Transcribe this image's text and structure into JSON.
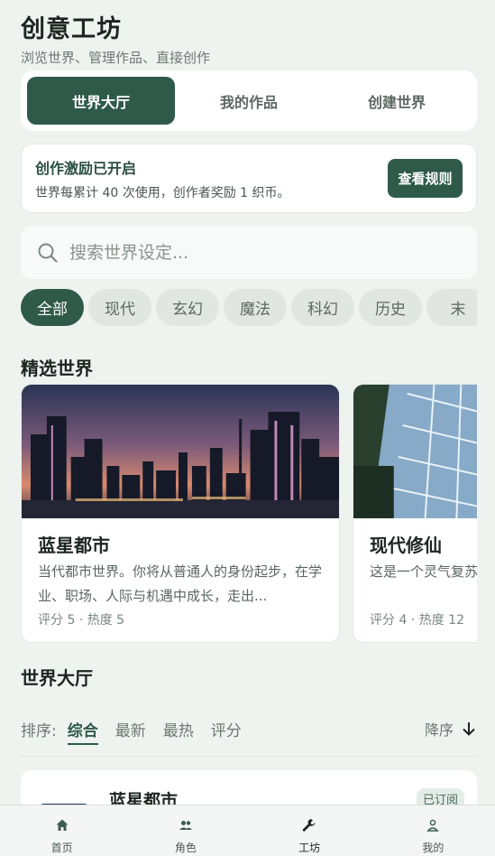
{
  "header": {
    "title": "创意工坊",
    "subtitle": "浏览世界、管理作品、直接创作"
  },
  "tabs": [
    {
      "label": "世界大厅",
      "active": true
    },
    {
      "label": "我的作品",
      "active": false
    },
    {
      "label": "创建世界",
      "active": false
    }
  ],
  "promo": {
    "title": "创作激励已开启",
    "description": "世界每累计 40 次使用，创作者奖励 1 织币。",
    "button_label": "查看规则"
  },
  "search": {
    "placeholder": "搜索世界设定...",
    "icon": "search-icon"
  },
  "categories": [
    "全部",
    "现代",
    "玄幻",
    "魔法",
    "科幻",
    "历史",
    "末"
  ],
  "featured": {
    "title": "精选世界",
    "cards": [
      {
        "title": "蓝星都市",
        "description": "当代都市世界。你将从普通人的身份起步，在学业、职场、人际与机遇中成长，走出...",
        "meta": "评分 5 · 热度 5"
      },
      {
        "title": "现代修仙",
        "description": "这是一个灵气复苏的世界，天地灵气重新充盈",
        "meta": "评分 4 · 热度 12"
      }
    ]
  },
  "hall": {
    "title": "世界大厅",
    "sort_label": "排序:",
    "sort_options": [
      {
        "label": "综合",
        "active": true
      },
      {
        "label": "最新",
        "active": false
      },
      {
        "label": "最热",
        "active": false
      },
      {
        "label": "评分",
        "active": false
      }
    ],
    "order_label": "降序",
    "items": [
      {
        "title": "蓝星都市",
        "badge": "已订阅"
      }
    ]
  },
  "nav": [
    {
      "label": "首页",
      "icon": "home-icon",
      "active": false
    },
    {
      "label": "角色",
      "icon": "people-icon",
      "active": false
    },
    {
      "label": "工坊",
      "icon": "wrench-icon",
      "active": true
    },
    {
      "label": "我的",
      "icon": "person-icon",
      "active": false
    }
  ],
  "colors": {
    "primary": "#2f5a4a",
    "background": "#eef3f0"
  }
}
